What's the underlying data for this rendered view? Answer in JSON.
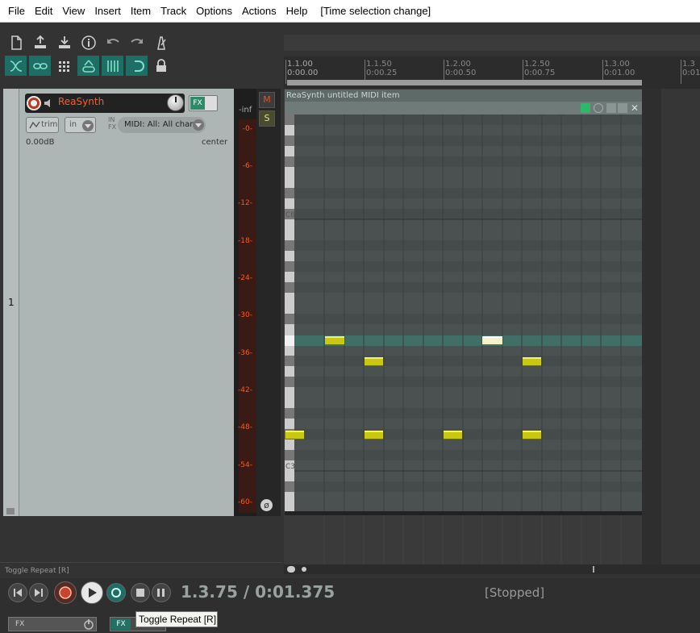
{
  "menu": {
    "items": [
      "File",
      "Edit",
      "View",
      "Insert",
      "Item",
      "Track",
      "Options",
      "Actions",
      "Help"
    ],
    "undo_title": "[Time selection change]"
  },
  "toolbar": {
    "row1_icons": [
      "new-project-icon",
      "save-upload-icon",
      "open-download-icon",
      "info-icon",
      "undo-icon",
      "redo-icon",
      "metronome-icon"
    ],
    "row2_icons": [
      "ripple-edit-icon",
      "grouping-icon",
      "grid-icon",
      "snap-icon",
      "auto-crossfade-icon",
      "loop-icon",
      "lock-icon"
    ]
  },
  "ruler": {
    "marks": [
      {
        "beat": "1.1.00",
        "time": "0:00.00"
      },
      {
        "beat": "1.1.50",
        "time": "0:00.25"
      },
      {
        "beat": "1.2.00",
        "time": "0:00.50"
      },
      {
        "beat": "1.2.50",
        "time": "0:00.75"
      },
      {
        "beat": "1.3.00",
        "time": "0:01.00"
      },
      {
        "beat": "1.3",
        "time": "0:01"
      }
    ]
  },
  "track": {
    "number": "1",
    "name": "ReaSynth",
    "fx_label": "FX",
    "trim_label": "trim",
    "input_label": "in",
    "infx_label": "IN FX",
    "midi_input": "MIDI: All: All chan",
    "volume": "0.00dB",
    "pan": "center",
    "mute_label": "M",
    "solo_label": "S",
    "meter_top": "-inf",
    "meter_scale": [
      "-0-",
      "-6-",
      "-12-",
      "-18-",
      "-24-",
      "-30-",
      "-36-",
      "-42-",
      "-48-",
      "-54-",
      "-60-"
    ]
  },
  "midi_item": {
    "title": "ReaSynth untitled MIDI item",
    "octave_labels": [
      "C6",
      "C3"
    ]
  },
  "transport": {
    "status": "Toggle Repeat [R]",
    "position": "1.3.75 / 0:01.375",
    "play_state": "[Stopped]",
    "master_fx_label": "FX",
    "fx2_label": "FX",
    "tooltip": "Toggle Repeat [R]"
  },
  "colors": {
    "accent": "#1e6e66",
    "note": "#c8c810",
    "record": "#b83a1c"
  }
}
